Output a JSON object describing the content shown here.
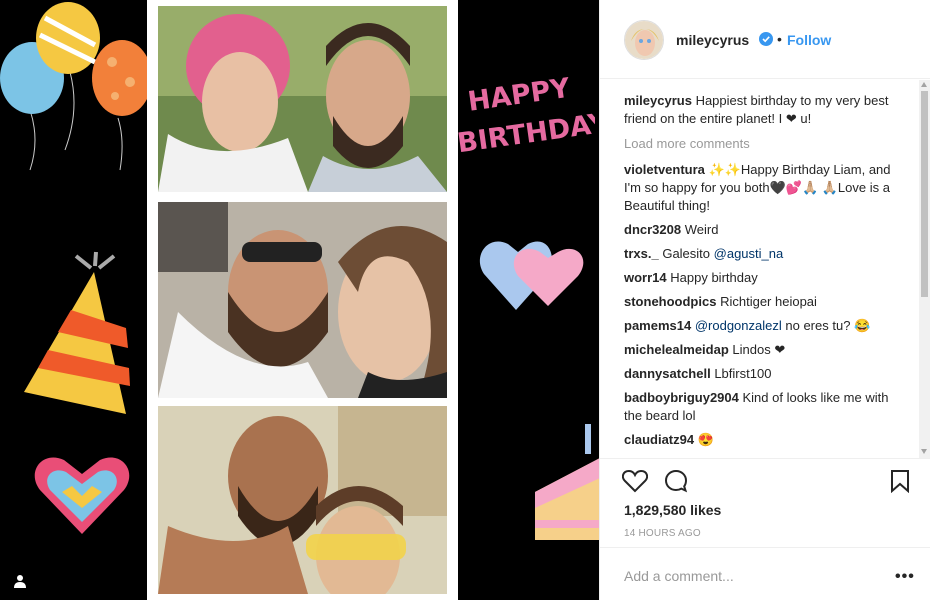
{
  "post": {
    "username": "mileycyrus",
    "follow_label": "Follow",
    "dot": "•",
    "caption": {
      "user": "mileycyrus",
      "text": "Happiest birthday to my very best friend on the entire planet! I ❤ u!"
    },
    "load_more": "Load more comments",
    "comments": [
      {
        "user": "violetventura",
        "pre": "✨✨Happy Birthday Liam, and I'm so happy for you both🖤💕🙏🏼\n🙏🏼Love is a Beautiful thing!",
        "mention": "",
        "post": ""
      },
      {
        "user": "dncr3208",
        "pre": "Weird",
        "mention": "",
        "post": ""
      },
      {
        "user": "trxs._",
        "pre": "Galesito ",
        "mention": "@agusti_na",
        "post": ""
      },
      {
        "user": "worr14",
        "pre": "Happy birthday",
        "mention": "",
        "post": ""
      },
      {
        "user": "stonehoodpics",
        "pre": "Richtiger heiopai",
        "mention": "",
        "post": ""
      },
      {
        "user": "pamems14",
        "pre": "",
        "mention": "@rodgonzalezl",
        "post": " no eres tu? 😂"
      },
      {
        "user": "michelealmeidap",
        "pre": "Lindos ❤",
        "mention": "",
        "post": ""
      },
      {
        "user": "dannysatchell",
        "pre": "Lbfirst100",
        "mention": "",
        "post": ""
      },
      {
        "user": "badboybriguy2904",
        "pre": "Kind of looks like me with the beard lol",
        "mention": "",
        "post": ""
      },
      {
        "user": "claudiatz94",
        "pre": "😍",
        "mention": "",
        "post": ""
      }
    ],
    "likes": "1,829,580 likes",
    "timestamp": "14 HOURS AGO",
    "add_comment_placeholder": "Add a comment...",
    "more_options": "•••",
    "decor_text": "HAPPY BIRTHDAY!"
  },
  "colors": {
    "accent": "#3897f0",
    "text": "#262626",
    "muted": "#999999",
    "mention": "#003569"
  },
  "icons": {
    "verified": "verified-badge-icon",
    "heart": "heart-icon",
    "comment": "comment-bubble-icon",
    "save": "bookmark-icon",
    "user_tag": "user-tag-icon"
  }
}
